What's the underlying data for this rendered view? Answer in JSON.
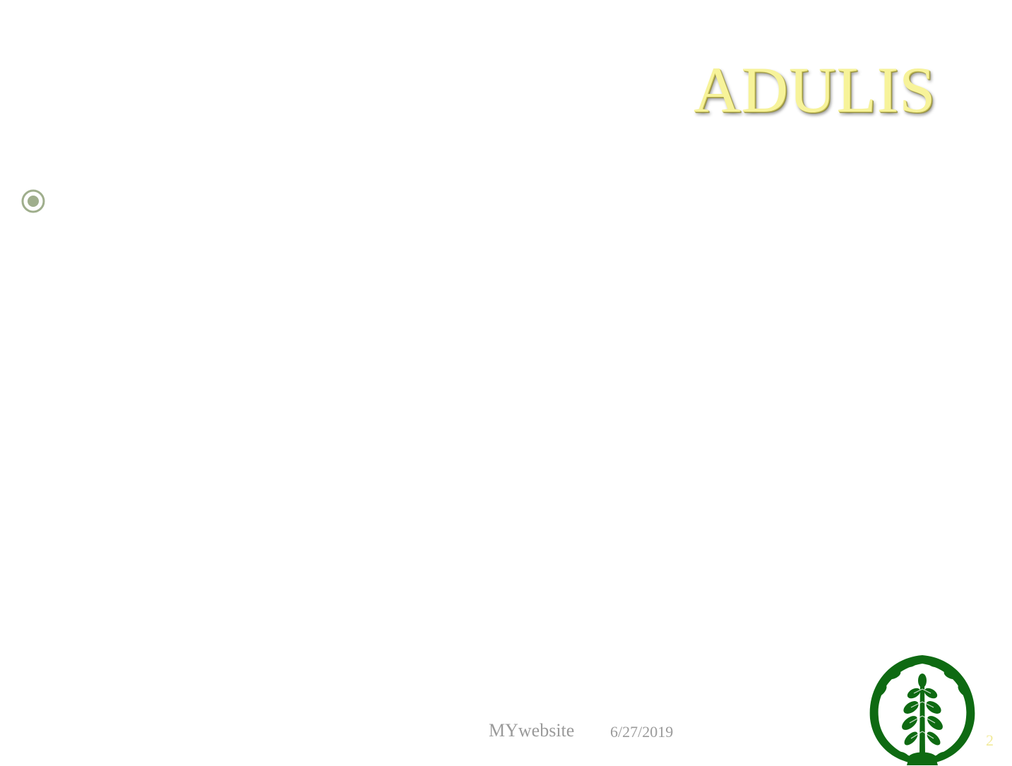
{
  "slide": {
    "title": "ADULIS",
    "bullet_icon": "radio-bullet-icon",
    "emblem_icon": "olive-wreath-emblem-icon",
    "footer": {
      "site": "MYwebsite",
      "date": "6/27/2019",
      "page_number": "2"
    },
    "colors": {
      "title": "#f7f39a",
      "bullet": "#9fae8c",
      "emblem": "#0e6a12",
      "footer_text": "#9a9a9a",
      "page_number": "#f2ea9a",
      "background": "#ffffff"
    }
  }
}
